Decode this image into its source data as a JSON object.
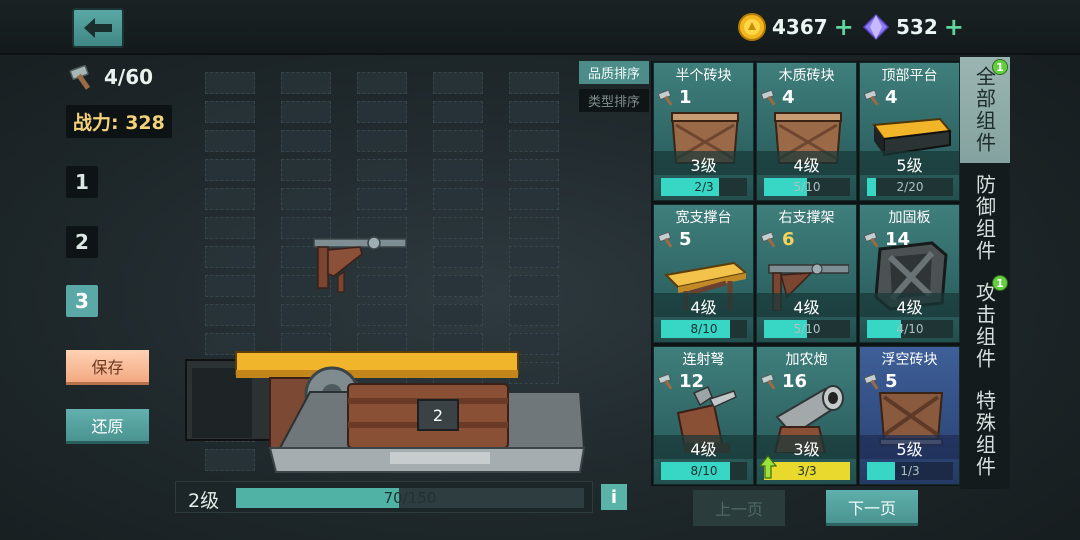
{
  "resources": {
    "gold": "4367",
    "gems": "532",
    "add_symbol": "+"
  },
  "build": {
    "hammer_count": "4/60",
    "power_label": "战力: 328",
    "slots": [
      "1",
      "2",
      "3"
    ],
    "active_slot": "3",
    "save_label": "保存",
    "restore_label": "还原",
    "level_label": "2级",
    "exp_text": "70/150",
    "exp_progress": 0.467,
    "center_part_label": "2",
    "info_label": "i"
  },
  "sort": {
    "quality": "品质排序",
    "type": "类型排序"
  },
  "cards": [
    {
      "name": "半个砖块",
      "cost": "1",
      "level": "3级",
      "progress": "2/3",
      "fill": 0.667,
      "art": "wood-crate"
    },
    {
      "name": "木质砖块",
      "cost": "4",
      "level": "4级",
      "progress": "5/10",
      "fill": 0.5,
      "art": "wood-crate"
    },
    {
      "name": "顶部平台",
      "cost": "4",
      "level": "5级",
      "progress": "2/20",
      "fill": 0.1,
      "art": "top-platform"
    },
    {
      "name": "宽支撑台",
      "cost": "5",
      "level": "4级",
      "progress": "8/10",
      "fill": 0.8,
      "art": "wide-support"
    },
    {
      "name": "右支撑架",
      "cost": "6",
      "level": "4级",
      "progress": "5/10",
      "fill": 0.5,
      "art": "right-bracket",
      "cost_gold": true
    },
    {
      "name": "加固板",
      "cost": "14",
      "level": "4级",
      "progress": "4/10",
      "fill": 0.4,
      "art": "reinforce-plate"
    },
    {
      "name": "连射弩",
      "cost": "12",
      "level": "4级",
      "progress": "8/10",
      "fill": 0.8,
      "art": "crossbow"
    },
    {
      "name": "加农炮",
      "cost": "16",
      "level": "3级",
      "progress": "3/3",
      "fill": 1.0,
      "art": "cannon",
      "upgradable": true
    },
    {
      "name": "浮空砖块",
      "cost": "5",
      "level": "5级",
      "progress": "1/3",
      "fill": 0.333,
      "art": "float-crate",
      "rare": true
    }
  ],
  "tabs": [
    {
      "label": "全部组件",
      "badge": "1",
      "active": true
    },
    {
      "label": "防御组件"
    },
    {
      "label": "攻击组件",
      "badge": "1"
    },
    {
      "label": "特殊组件"
    }
  ],
  "pager": {
    "prev": "上一页",
    "next": "下一页"
  }
}
